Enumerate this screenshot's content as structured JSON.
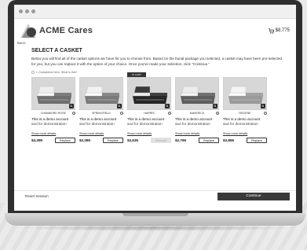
{
  "brand": {
    "name": "ACME Cares"
  },
  "header": {
    "cart_total": "$8,775",
    "back_label": "BACK"
  },
  "page": {
    "title": "SELECT A CASKET",
    "intro": "Below you will find all of the casket options we have for you to choose from. Based on the burial package you selected, a casket may have been pre-selected for you, but you can replace it with the option of your choice. Once you've made your selection, click \"Continue.\"",
    "legend": "= Guaranteed item. What is this?"
  },
  "caskets": [
    {
      "name": "CHAMBORD ROSE",
      "demo_line1": "This is a demo account",
      "demo_line2": "and for demonstration",
      "details": "Show more details",
      "price": "$4,395",
      "action": "Replace",
      "badge": "",
      "selected": false
    },
    {
      "name": "SPRINGFIELD",
      "demo_line1": "This is a demo account",
      "demo_line2": "and for demonstration",
      "details": "Show more details",
      "price": "$2,085",
      "action": "Replace",
      "badge": "",
      "selected": false
    },
    {
      "name": "HARRIS",
      "demo_line1": "This is a demo account",
      "demo_line2": "and for demonstration",
      "details": "Show more details",
      "price": "$3,635",
      "action": "Selected",
      "badge": "IN CART",
      "selected": true
    },
    {
      "name": "MAVERICK",
      "demo_line1": "This is a demo account",
      "demo_line2": "and for demonstration",
      "details": "Show more details",
      "price": "$2,765",
      "action": "Replace",
      "badge": "",
      "selected": false
    },
    {
      "name": "REGENE",
      "demo_line1": "This is a demo account",
      "demo_line2": "and for demonstration",
      "details": "Show more details",
      "price": "$3,865",
      "action": "Replace",
      "badge": "",
      "selected": false
    }
  ],
  "footer": {
    "reset_label": "Reset Session",
    "continue_label": "Continue"
  },
  "colors": {
    "accent_dark": "#3a3a3a",
    "casket_wood": "#8a8a8a",
    "casket_dark": "#2a2a2a",
    "casket_light": "#e8e8e8"
  }
}
